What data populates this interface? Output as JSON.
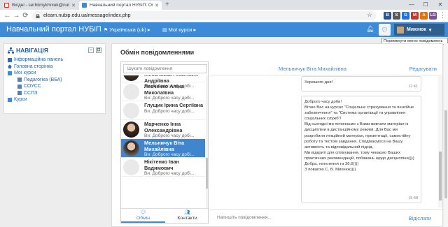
{
  "browser": {
    "tabs": [
      {
        "title": "Вхідні - serhiimykhniuk@nubip...",
        "active": false
      },
      {
        "title": "Навчальний портал НУБіП: Обм",
        "active": true
      }
    ],
    "new_tab": "+",
    "url": "elearn.nubip.edu.ua/message/index.php",
    "window_controls": {
      "minimize": "—",
      "maximize": "☐",
      "close": "✕"
    },
    "extensions": [
      "B",
      "S",
      "G",
      "M",
      "A",
      "LG"
    ]
  },
  "navbar": {
    "brand": "Навчальний портал НУБіП",
    "language": "Українська (uk)",
    "courses_menu": "Мої курси",
    "user_name": "Михнюк",
    "tooltip": "Перемкнути меню повідомлень"
  },
  "nav_block": {
    "title": "НАВІГАЦІЯ",
    "items": [
      {
        "label": "Інформаційна панель",
        "level": 0,
        "icon": "dashboard-icon"
      },
      {
        "label": "Головна сторінка",
        "level": 0,
        "icon": "home-icon"
      },
      {
        "label": "Мої курси",
        "level": 0,
        "icon": "folder-icon"
      },
      {
        "label": "Педагогіка (ВБА)",
        "level": 1,
        "icon": "course-icon"
      },
      {
        "label": "СОУСС",
        "level": 1,
        "icon": "course-icon"
      },
      {
        "label": "ССПЗ",
        "level": 1,
        "icon": "course-icon"
      },
      {
        "label": "Курси",
        "level": 0,
        "icon": "folder-icon"
      }
    ]
  },
  "main": {
    "title": "Обмін повідомленнями",
    "search_placeholder": "Шукати повідомлення",
    "contacts": [
      {
        "name": "Миколаєва Анастасія Андріївна",
        "preview": "Ви: Доброго часу добі...",
        "photo": true,
        "selected": false
      },
      {
        "name": "Левченко Аліна Миколаївна",
        "preview": "Ви: Доброго часу добі...",
        "photo": false,
        "selected": false
      },
      {
        "name": "Глущик Ірина Сергіївна",
        "preview": "Ви: Доброго часу добі...",
        "photo": false,
        "selected": false
      },
      {
        "name": "Марченко Інна Олександрівна",
        "preview": "Ви: Доброго часу добі...",
        "photo": true,
        "selected": false
      },
      {
        "name": "Мельничук Віта Михайлівна",
        "preview": "Ви: Доброго часу добі...",
        "photo": true,
        "selected": true
      },
      {
        "name": "Нікітенко Іван Вадимович",
        "preview": "Ви: Доброго часу добі...",
        "photo": false,
        "selected": false
      }
    ],
    "tabs": [
      {
        "label": "Обмін",
        "icon": "chat-icon",
        "active": true
      },
      {
        "label": "Контакти",
        "icon": "users-icon",
        "active": false
      }
    ],
    "conversation": {
      "contact_name": "Мельничук Віта Михайлівна",
      "edit_label": "Редагувати",
      "messages": [
        {
          "text": "Хорошого дня!",
          "time": "12:41"
        },
        {
          "text": "Доброго часу доби!\nВітаю Вас на курсах \"Соціальне страхування та пенсійне забезпечення\" та \"Система організації та управління соціальних служб\"!\nВід сьогодні ми починаємо з Вами вивчати матеріал із дисципліни в дистанційному режимі. Для Вас ми розробили лекційний матеріал, презентації, самостійну роботу та тестові завдання. Сподіваємося на Вашу активність та відповідальний підхід.\nМи відкриті для спілкування, тому чекаємо Ваших практичних рекомендацій, побажань щодо дисципліни))))\nДобра, натхнення та 36,6))))\nЗ повагою С. В. Михнюк))))",
          "time": "15:48"
        }
      ],
      "input_placeholder": "Напишіть повідомлення...",
      "send_label": "Відіслати"
    }
  }
}
